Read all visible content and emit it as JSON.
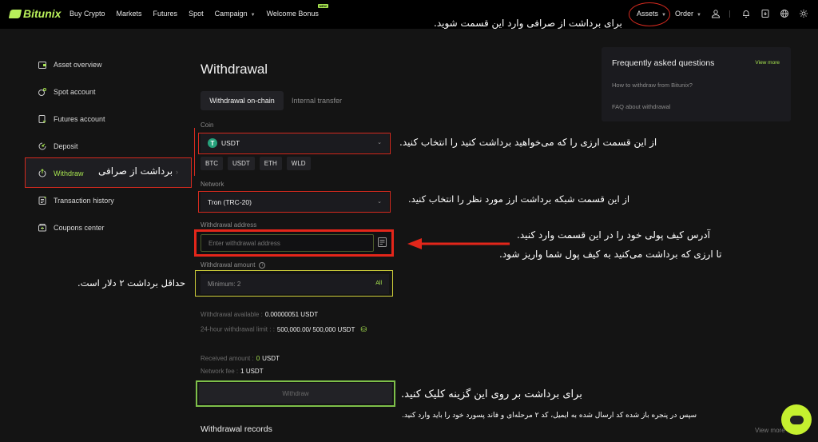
{
  "topnav": {
    "logo": "Bitunix",
    "links": [
      "Buy Crypto",
      "Markets",
      "Futures",
      "Spot",
      "Campaign",
      "Welcome Bonus"
    ],
    "new_badge": "NEW",
    "assets": "Assets",
    "order": "Order"
  },
  "sidebar": {
    "items": [
      {
        "label": "Asset overview",
        "icon": "wallet-icon"
      },
      {
        "label": "Spot account",
        "icon": "coins-icon"
      },
      {
        "label": "Futures account",
        "icon": "futures-icon"
      },
      {
        "label": "Deposit",
        "icon": "deposit-icon"
      },
      {
        "label": "Withdraw",
        "icon": "withdraw-icon",
        "active": true
      },
      {
        "label": "Transaction history",
        "icon": "history-icon"
      },
      {
        "label": "Coupons center",
        "icon": "coupon-icon"
      }
    ]
  },
  "main": {
    "title": "Withdrawal",
    "tabs": [
      "Withdrawal on-chain",
      "Internal transfer"
    ],
    "coin_label": "Coin",
    "coin_value": "USDT",
    "coin_icon_glyph": "T",
    "coin_chips": [
      "BTC",
      "USDT",
      "ETH",
      "WLD"
    ],
    "network_label": "Network",
    "network_value": "Tron (TRC-20)",
    "address_label": "Withdrawal address",
    "address_placeholder": "Enter withdrawal address",
    "amount_label": "Withdrawal amount",
    "amount_placeholder": "Minimum: 2",
    "amount_all": "All",
    "available_label": "Withdrawal available :",
    "available_value": "0.00000051 USDT",
    "limit_label": "24-hour withdrawal limit : :",
    "limit_value": "500,000.00/ 500,000 USDT",
    "received_label": "Received amount :",
    "received_num": "0",
    "received_unit": "USDT",
    "fee_label": "Network fee :",
    "fee_value": "1 USDT",
    "withdraw_button": "Withdraw",
    "records_title": "Withdrawal records"
  },
  "faq": {
    "title": "Frequently asked questions",
    "view_more": "View more",
    "questions": [
      "How to withdraw from Bitunix?",
      "FAQ about withdrawal"
    ]
  },
  "annotations": {
    "assets_hint": "برای برداشت از صرافی وارد این قسمت شوید.",
    "sidebar_hint": "برداشت از صرافی",
    "coin_hint": "از این قسمت ارزی را که می‌خواهید برداشت کنید را انتخاب کنید.",
    "network_hint": "از این قسمت شبکه برداشت ارز مورد نظر را انتخاب کنید.",
    "address_hint_1": "آدرس کیف پولی خود را در این قسمت وارد کنید.",
    "address_hint_2": "تا ارزی که برداشت می‌کنید به کیف پول شما واریز شود.",
    "min_hint": "حداقل برداشت ۲ دلار است.",
    "withdraw_hint": "برای برداشت بر روی این گزینه کلیک کنید.",
    "twofa_hint": "سپس در پنجره باز شده کد ارسال شده به ایمیل، کد ۲ مرحله‌ای و فاند پسورد خود را باید وارد کنید."
  },
  "footer": {
    "view_more": "View more"
  },
  "colors": {
    "accent": "#a6e34f",
    "highlight_red": "#d42a1f",
    "highlight_yellow": "#cfcf3a",
    "highlight_green": "#7ec04a",
    "usdt": "#26a17b"
  }
}
